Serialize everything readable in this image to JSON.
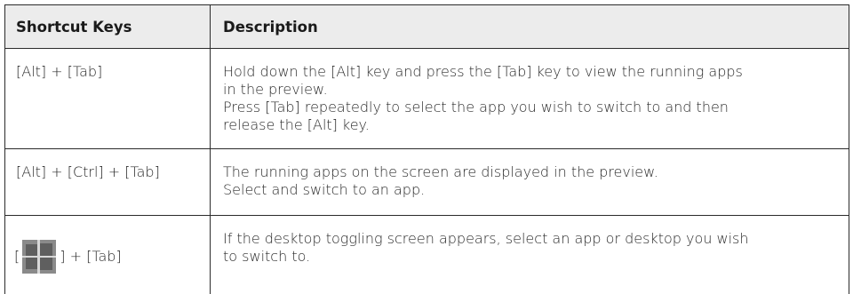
{
  "table": {
    "headers": {
      "shortcut_keys": "Shortcut Keys",
      "description": "Description"
    },
    "rows": [
      {
        "keys": "[Alt] + [Tab]",
        "description": [
          "Hold down the [Alt] key and press the [Tab] key to view the running apps",
          "in the preview.",
          "Press [Tab] repeatedly to select the app you wish to switch to and then",
          "release the [Alt] key."
        ]
      },
      {
        "keys": "[Alt] + [Ctrl] + [Tab]",
        "description": [
          "The running apps on the screen are displayed in the preview.",
          "Select and switch to an app."
        ]
      },
      {
        "keys_prefix": "[",
        "keys_icon": "windows-logo-icon",
        "keys_suffix": "] + [Tab]",
        "description": [
          "If the desktop toggling screen appears, select an app or desktop you wish",
          "to switch to."
        ]
      }
    ]
  }
}
